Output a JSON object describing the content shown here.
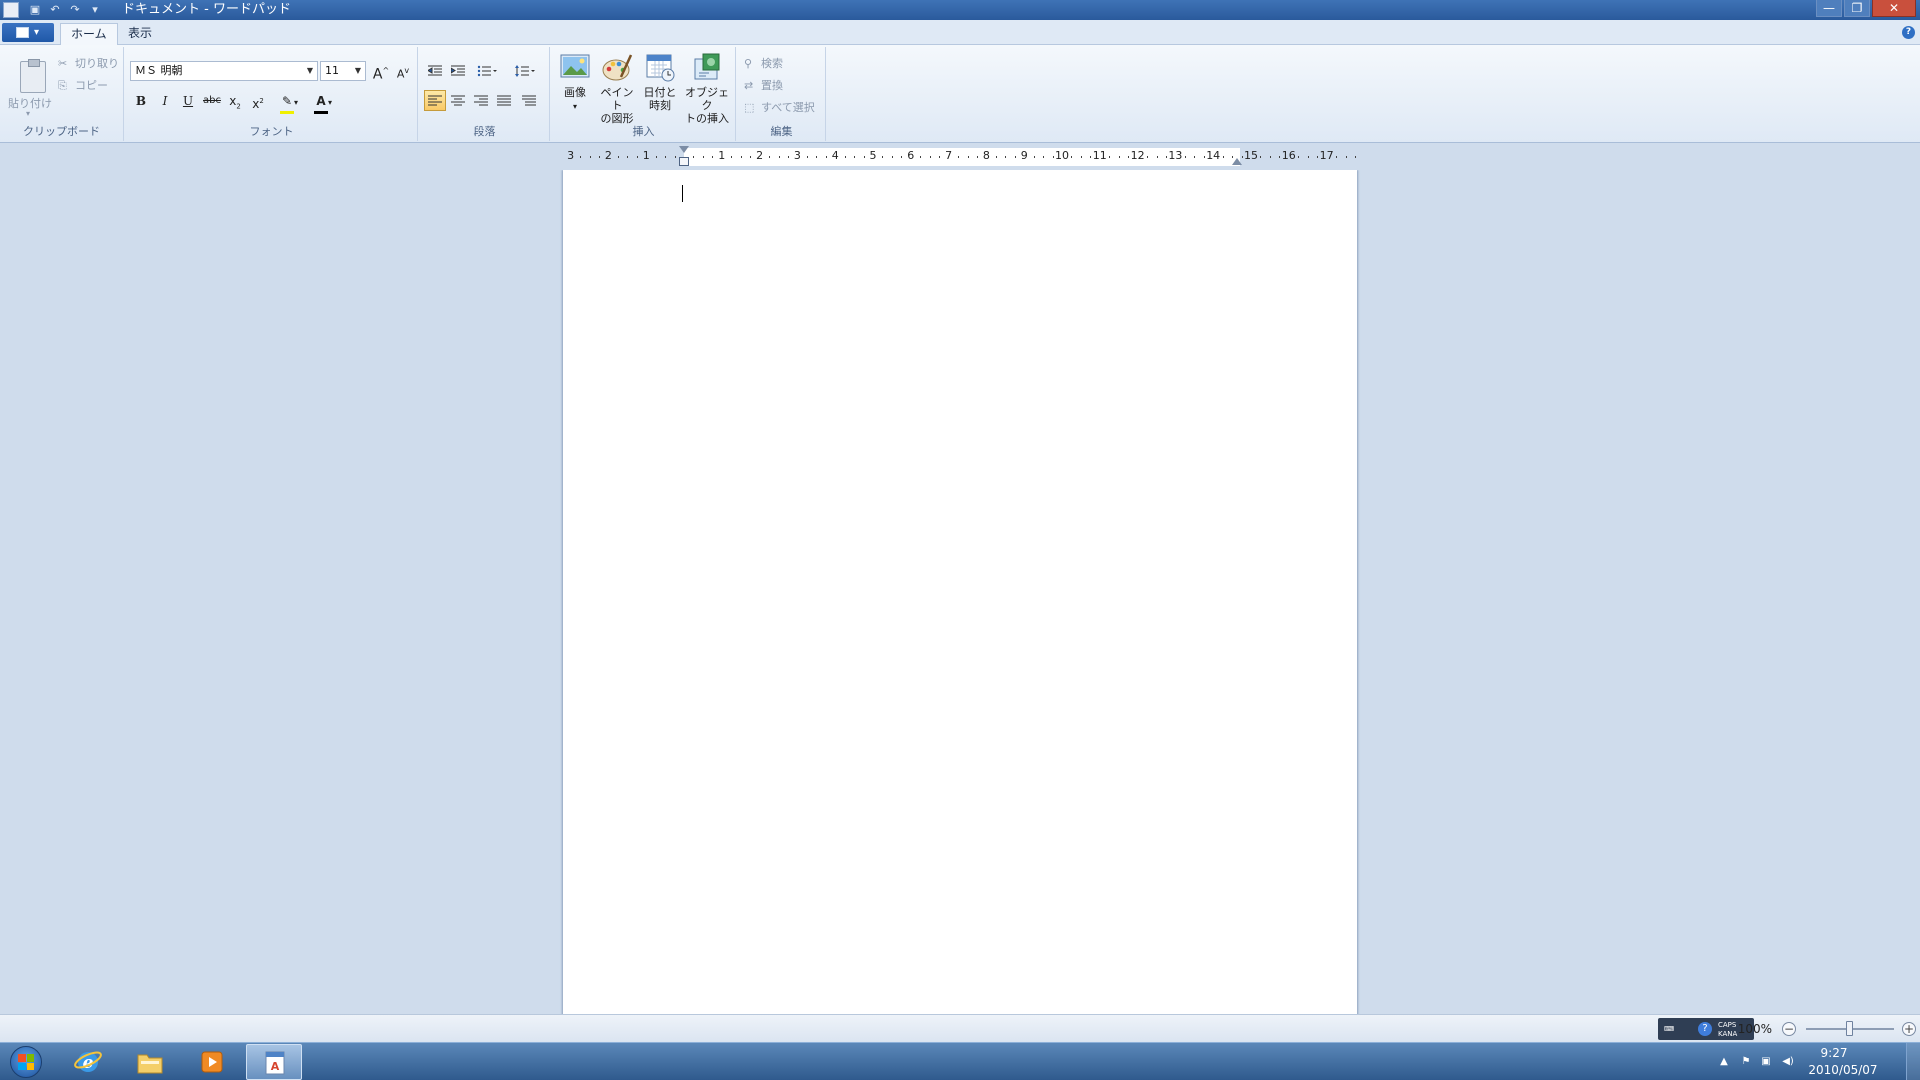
{
  "window": {
    "title": "ドキュメント - ワードパッド",
    "controls": {
      "minimize": "—",
      "maximize": "❐",
      "close": "✕"
    }
  },
  "quick_access": {
    "save_icon": "save-icon",
    "undo_icon": "undo-icon",
    "redo_icon": "redo-icon",
    "customize_icon": "customize-icon"
  },
  "tabs": [
    {
      "label": "ホーム",
      "active": true
    },
    {
      "label": "表示",
      "active": false
    }
  ],
  "help_label": "?",
  "ribbon": {
    "clipboard": {
      "label": "クリップボード",
      "paste": "貼り付け",
      "cut": "切り取り",
      "copy": "コピー"
    },
    "font": {
      "label": "フォント",
      "family": "ＭＳ 明朝",
      "size": "11",
      "grow": "A",
      "shrink": "A",
      "bold": "B",
      "italic": "I",
      "underline": "U",
      "strike": "abc",
      "subscript": "x",
      "superscript": "x",
      "highlight_color": "#ffff00",
      "text_color": "#e11d1d",
      "text_color_glyph": "A"
    },
    "paragraph": {
      "label": "段落"
    },
    "insert": {
      "label": "挿入",
      "picture_line1": "画像",
      "paint_line1": "ペイント",
      "paint_line2": "の図形",
      "datetime_line1": "日付と",
      "datetime_line2": "時刻",
      "object_line1": "オブジェク",
      "object_line2": "トの挿入"
    },
    "edit": {
      "label": "編集",
      "find": "検索",
      "replace": "置換",
      "select_all": "すべて選択"
    }
  },
  "ruler": {
    "left_numbers": [
      "3",
      "2",
      "1"
    ],
    "right_numbers": [
      "1",
      "2",
      "3",
      "4",
      "5",
      "6",
      "7",
      "8",
      "9",
      "10",
      "11",
      "12",
      "13",
      "14",
      "15",
      "16",
      "17"
    ]
  },
  "statusbar": {
    "zoom": "100%",
    "zoom_level": 0.5,
    "ime_line1": "CAPS",
    "ime_line2": "KANA"
  },
  "taskbar": {
    "apps": [
      "internet-explorer-icon",
      "windows-explorer-icon",
      "media-player-icon",
      "wordpad-icon"
    ],
    "time": "9:27",
    "date": "2010/05/07"
  }
}
